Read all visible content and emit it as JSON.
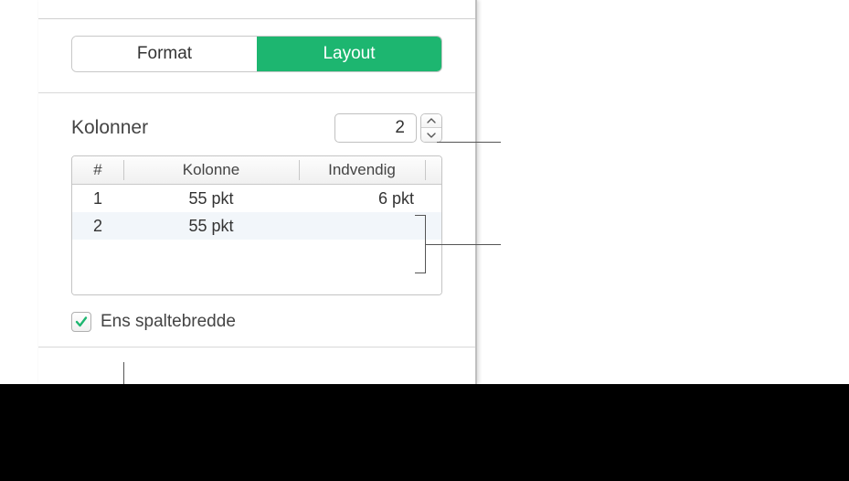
{
  "tabs": {
    "format": "Format",
    "layout": "Layout"
  },
  "columns": {
    "label": "Kolonner",
    "count": "2"
  },
  "table": {
    "headers": {
      "num": "#",
      "column": "Kolonne",
      "gutter": "Indvendig"
    },
    "rows": [
      {
        "num": "1",
        "width": "55 pkt",
        "gutter": "6 pkt"
      },
      {
        "num": "2",
        "width": "55 pkt",
        "gutter": ""
      }
    ]
  },
  "equalWidth": {
    "label": "Ens spaltebredde",
    "checked": true
  }
}
